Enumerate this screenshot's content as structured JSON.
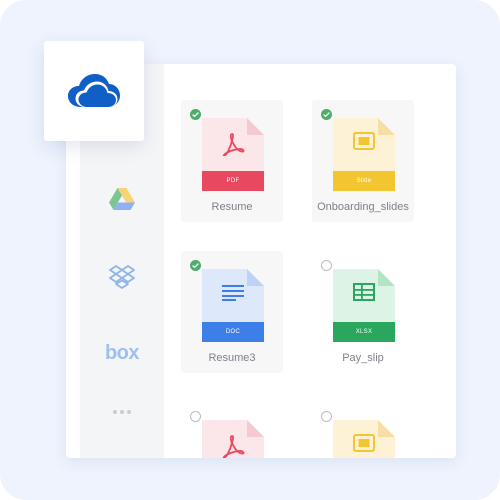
{
  "sidebar": {
    "providers": [
      {
        "name": "onedrive",
        "icon": "onedrive-icon",
        "color": "#0f5fc6"
      },
      {
        "name": "google-drive",
        "icon": "google-drive-icon"
      },
      {
        "name": "dropbox",
        "icon": "dropbox-icon",
        "color": "#8fb4e8"
      },
      {
        "name": "box",
        "icon": "box-icon",
        "label": "box",
        "color": "#9cc0ef"
      },
      {
        "name": "more",
        "icon": "more-icon",
        "color": "#c9ccd2"
      }
    ]
  },
  "files": [
    {
      "label": "Resume",
      "type": "PDF",
      "checked": true,
      "icon": "pdf-icon",
      "accent": "#e84960",
      "tint": "#fbe6ea"
    },
    {
      "label": "Onboarding_slides",
      "type": "Slide",
      "checked": true,
      "icon": "slides-icon",
      "accent": "#f3c531",
      "tint": "#fdf1d6"
    },
    {
      "label": "Resume3",
      "type": "DOC",
      "checked": true,
      "icon": "doc-icon",
      "accent": "#3d7fe8",
      "tint": "#dde8fb"
    },
    {
      "label": "Pay_slip",
      "type": "XLSX",
      "checked": false,
      "icon": "sheet-icon",
      "accent": "#2aa65e",
      "tint": "#dcf3e5"
    },
    {
      "label": "",
      "type": "",
      "checked": false,
      "icon": "pdf-icon",
      "accent": "#e84960",
      "tint": "#fbe6ea"
    },
    {
      "label": "",
      "type": "",
      "checked": false,
      "icon": "slides-icon",
      "accent": "#f3c531",
      "tint": "#fdf1d6"
    }
  ]
}
